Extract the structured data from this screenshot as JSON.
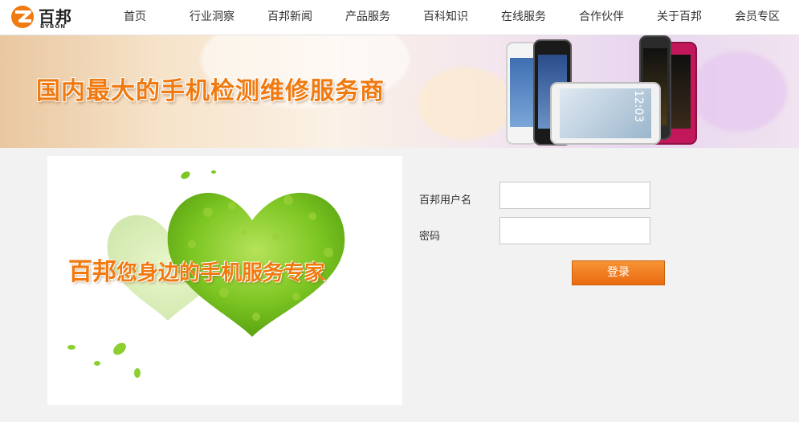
{
  "header": {
    "brand": "百邦",
    "brand_sub": "BYBON"
  },
  "nav": {
    "items": [
      {
        "label": "首页"
      },
      {
        "label": "行业洞察"
      },
      {
        "label": "百邦新闻"
      },
      {
        "label": "产品服务"
      },
      {
        "label": "百科知识"
      },
      {
        "label": "在线服务"
      },
      {
        "label": "合作伙伴"
      },
      {
        "label": "关于百邦"
      },
      {
        "label": "会员专区"
      }
    ]
  },
  "banner": {
    "headline": "国内最大的手机检测维修服务商",
    "phone_clock": "12:03"
  },
  "promo": {
    "brand": "百邦",
    "slogan": "您身边的手机服务专家"
  },
  "login": {
    "username_label": "百邦用户名",
    "username_value": "",
    "password_label": "密码",
    "password_value": "",
    "submit_label": "登录"
  },
  "colors": {
    "accent": "#f07a10",
    "leaf_green": "#7dc623"
  }
}
